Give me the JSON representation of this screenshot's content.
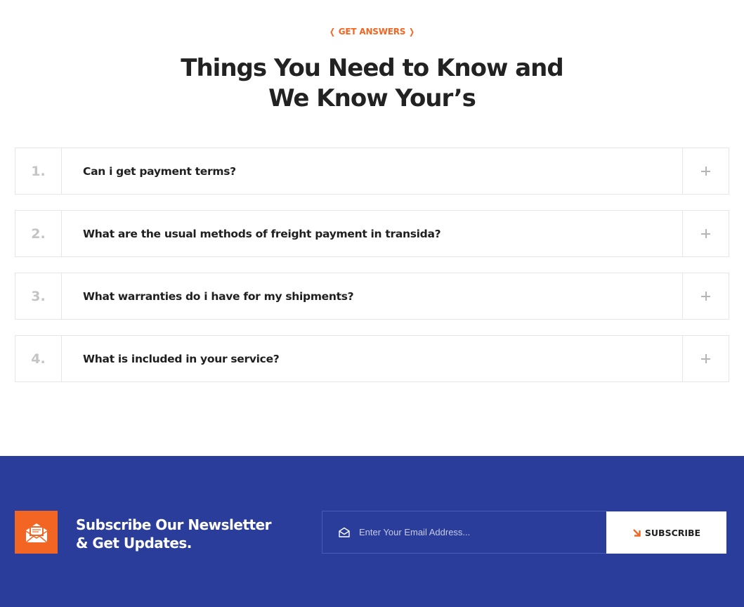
{
  "faq": {
    "eyebrow": "GET ANSWERS",
    "heading_line1": "Things You Need to Know and",
    "heading_line2": "We Know Your’s",
    "items": [
      {
        "number": "1.",
        "question": "Can i get payment terms?"
      },
      {
        "number": "2.",
        "question": "What are the usual methods of freight payment in transida?"
      },
      {
        "number": "3.",
        "question": "What warranties do i have for my shipments?"
      },
      {
        "number": "4.",
        "question": "What is included in your service?"
      }
    ],
    "toggle_icon": "plus-icon"
  },
  "newsletter": {
    "title_line1": "Subscribe Our Newsletter",
    "title_line2": "& Get Updates.",
    "email_placeholder": "Enter Your Email Address...",
    "subscribe_label": "SUBSCRIBE",
    "icons": {
      "badge": "envelope-open-icon",
      "input": "envelope-icon",
      "button": "arrow-down-right-icon"
    }
  },
  "colors": {
    "accent": "#f26522",
    "newsletter_bg": "#2a3d9a",
    "heading": "#222222",
    "number": "#c4c4c4"
  }
}
